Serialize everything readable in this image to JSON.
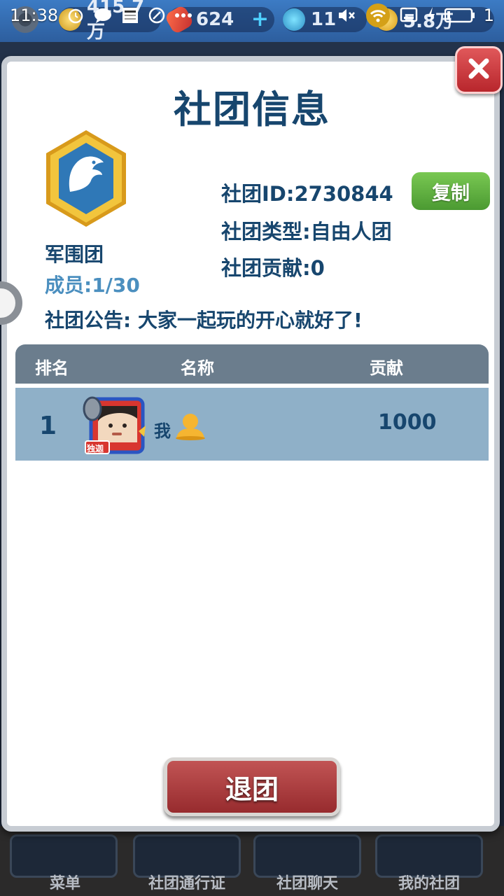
{
  "status_bar": {
    "time": "11:38",
    "battery_level": "1"
  },
  "top_bar": {
    "gold": "415.7万",
    "boards": "624",
    "keys": "11",
    "coins": "5.8万"
  },
  "modal": {
    "title": "社团信息",
    "club_name": "军围团",
    "members": "成员:1/30",
    "club_id": "社团ID:2730844",
    "copy_label": "复制",
    "club_type": "社团类型:自由人团",
    "club_contribution": "社团贡献:0",
    "announcement": "社团公告: 大家一起玩的开心就好了!",
    "table": {
      "headers": [
        "排名",
        "名称",
        "贡献"
      ],
      "rows": [
        {
          "rank": "1",
          "name": "我",
          "contribution": "1000",
          "badge": "独迦"
        }
      ]
    },
    "quit_label": "退团"
  },
  "bottom_nav": {
    "items": [
      {
        "label": "菜单"
      },
      {
        "label": "社团通行证"
      },
      {
        "label": "社团聊天"
      },
      {
        "label": "我的社团"
      }
    ]
  },
  "colors": {
    "title_blue": "#17466e",
    "accent_green": "#4b9a32",
    "danger_red": "#972b2e",
    "row_blue": "#8fb0c8"
  },
  "icons": [
    "gear-icon",
    "alarm-icon",
    "chat-icon",
    "news-icon",
    "clock-icon",
    "more-icon",
    "mute-icon",
    "wifi-icon",
    "screenshot-icon",
    "charging-icon",
    "battery-icon",
    "close-icon",
    "eagle-emblem-icon",
    "person-icon"
  ]
}
